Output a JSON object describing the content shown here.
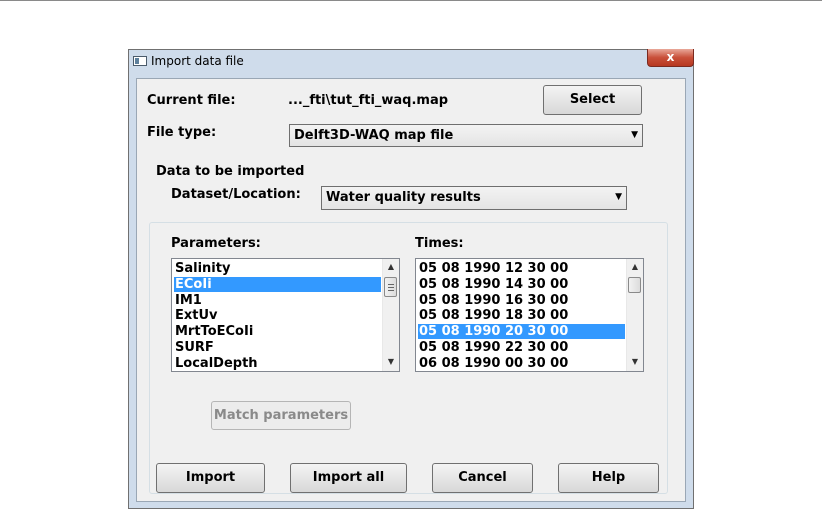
{
  "dialog": {
    "title": "Import data file",
    "close_glyph": "x"
  },
  "current_file": {
    "label": "Current file:",
    "value": "..._fti\\tut_fti_waq.map",
    "select_label": "Select"
  },
  "file_type": {
    "label": "File type:",
    "selected": "Delft3D-WAQ map file"
  },
  "data_group": {
    "caption": "Data to be imported",
    "dataset_label": "Dataset/Location:",
    "dataset_selected": "Water quality results",
    "parameters_label": "Parameters:",
    "times_label": "Times:",
    "match_label": "Match parameters"
  },
  "parameters": [
    {
      "label": "Salinity",
      "selected": false
    },
    {
      "label": "ECoIi",
      "selected": true
    },
    {
      "label": "IM1",
      "selected": false
    },
    {
      "label": "ExtUv",
      "selected": false
    },
    {
      "label": "MrtToECoIi",
      "selected": false
    },
    {
      "label": "SURF",
      "selected": false
    },
    {
      "label": "LocalDepth",
      "selected": false
    }
  ],
  "times": [
    {
      "label": "05 08 1990 12 30 00",
      "selected": false
    },
    {
      "label": "05 08 1990 14 30 00",
      "selected": false
    },
    {
      "label": "05 08 1990 16 30 00",
      "selected": false
    },
    {
      "label": "05 08 1990 18 30 00",
      "selected": false
    },
    {
      "label": "05 08 1990 20 30 00",
      "selected": true
    },
    {
      "label": "05 08 1990 22 30 00",
      "selected": false
    },
    {
      "label": "06 08 1990 00 30 00",
      "selected": false
    }
  ],
  "buttons": {
    "import": "Import",
    "import_all": "Import all",
    "cancel": "Cancel",
    "help": "Help"
  },
  "colors": {
    "selection": "#3399ff",
    "frame": "#cfdceb",
    "close": "#c9503a"
  },
  "icons": {
    "scroll_up": "▲",
    "scroll_down": "▼",
    "dropdown": "▼"
  }
}
